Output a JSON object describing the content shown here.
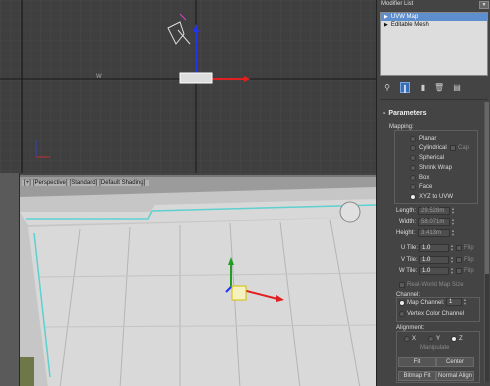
{
  "viewport_top": {
    "label": "W"
  },
  "viewport_perspective": {
    "label_parts": [
      "[+]",
      "[Perspective]",
      "[Standard]",
      "[Default Shading]"
    ]
  },
  "modifier_panel": {
    "title": "Modifier List",
    "stack": [
      {
        "label": "UVW Map",
        "selected": true
      },
      {
        "label": "Editable Mesh",
        "selected": false
      }
    ]
  },
  "toolbar": {
    "icons": [
      "pin-stack-icon",
      "show-end-result-icon",
      "make-unique-icon",
      "remove-modifier-icon",
      "configure-modifier-sets-icon"
    ]
  },
  "parameters": {
    "title": "Parameters",
    "mapping_label": "Mapping:",
    "mapping_options": [
      {
        "label": "Planar",
        "checked": false
      },
      {
        "label": "Cylindrical",
        "checked": false
      },
      {
        "label": "Spherical",
        "checked": false
      },
      {
        "label": "Shrink Wrap",
        "checked": false
      },
      {
        "label": "Box",
        "checked": false
      },
      {
        "label": "Face",
        "checked": false
      },
      {
        "label": "XYZ to UVW",
        "checked": true
      }
    ],
    "cap_label": "Cap",
    "length_label": "Length:",
    "length_value": "29.528m",
    "width_label": "Width:",
    "width_value": "58.071m",
    "height_label": "Height:",
    "height_value": "3.413m",
    "u_tile_label": "U Tile:",
    "u_tile_value": "1.0",
    "v_tile_label": "V Tile:",
    "v_tile_value": "1.0",
    "w_tile_label": "W Tile:",
    "w_tile_value": "1.0",
    "flip_label": "Flip",
    "real_world_label": "Real-World Map Size",
    "channel_label": "Channel:",
    "map_channel_label": "Map Channel:",
    "map_channel_value": "1",
    "vertex_color_label": "Vertex Color Channel",
    "alignment_label": "Alignment:",
    "align_x": "X",
    "align_y": "Y",
    "align_z": "Z",
    "manipulate_label": "Manipulate",
    "fit_label": "Fit",
    "center_label": "Center",
    "bitmap_fit_label": "Bitmap Fit",
    "normal_align_label": "Normal Align"
  }
}
